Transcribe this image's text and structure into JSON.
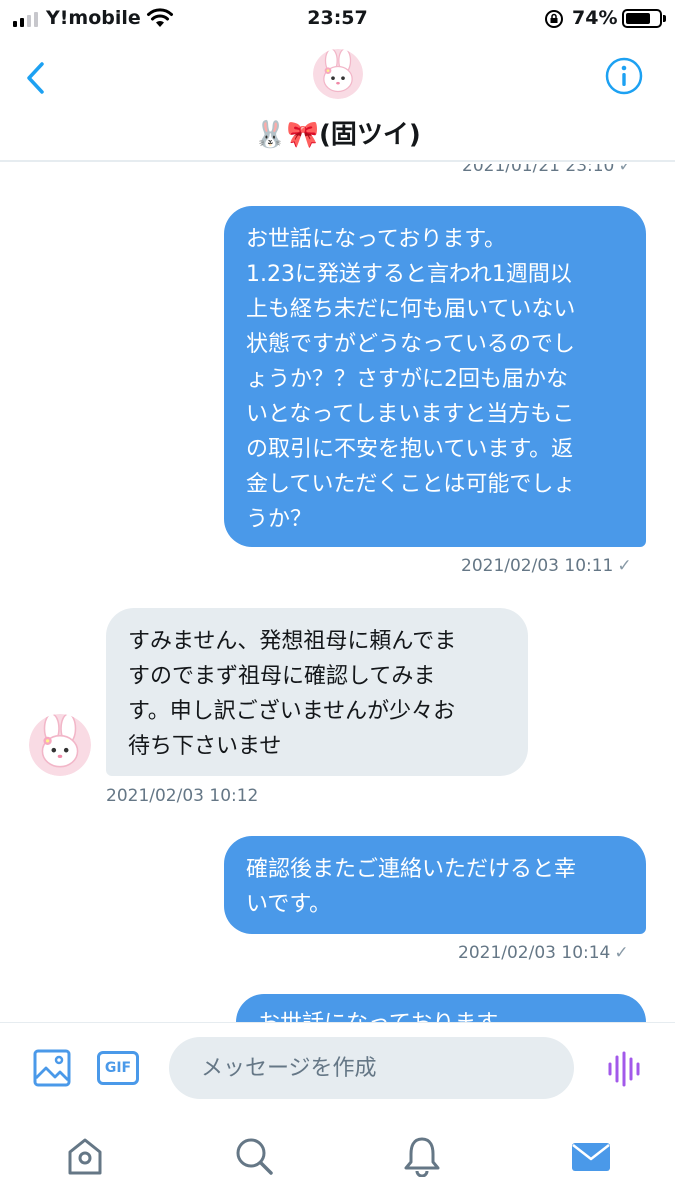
{
  "status_bar": {
    "carrier": "Y!mobile",
    "time": "23:57",
    "battery_percent": "74%",
    "battery_level": 0.74
  },
  "header": {
    "title": "🐰🎀(固ツイ)",
    "back_icon": "chevron-left-icon",
    "info_icon": "info-icon",
    "colors": {
      "accent": "#1da1f2"
    }
  },
  "messages": [
    {
      "direction": "out",
      "text": "",
      "timestamp": "2021/01/21 23:10",
      "partial": true
    },
    {
      "direction": "out",
      "text": "お世話になっております。\n1.23に発送すると言われ1週間以\n上も経ち未だに何も届いていない\n状態ですがどうなっているのでし\nょうか？？さすがに2回も届かな\nいとなってしまいますと当方もこ\nの取引に不安を抱いています。返\n金していただくことは可能でしょ\nうか？",
      "timestamp": "2021/02/03 10:11"
    },
    {
      "direction": "in",
      "text": "すみません、発想祖母に頼んでま\nすのでまず祖母に確認してみま\nす。申し訳ございませんが少々お\n待ち下さいませ",
      "timestamp": "2021/02/03 10:12"
    },
    {
      "direction": "out",
      "text": "確認後またご連絡いただけると幸\nいです。",
      "timestamp": "2021/02/03 10:14"
    },
    {
      "direction": "out",
      "text": "お世話になっております。",
      "timestamp": "",
      "partial": true
    }
  ],
  "colors": {
    "outgoing_bubble": "#4a99e9",
    "incoming_bubble": "#e6ecf0",
    "timestamp": "#657786"
  },
  "composer": {
    "placeholder": "メッセージを作成",
    "gif_label": "GIF",
    "media_icon": "image-icon",
    "voice_icon": "voice-waveform-icon"
  },
  "tabbar": {
    "items": [
      "home-icon",
      "search-icon",
      "notifications-icon",
      "messages-icon"
    ],
    "active": "messages-icon"
  }
}
